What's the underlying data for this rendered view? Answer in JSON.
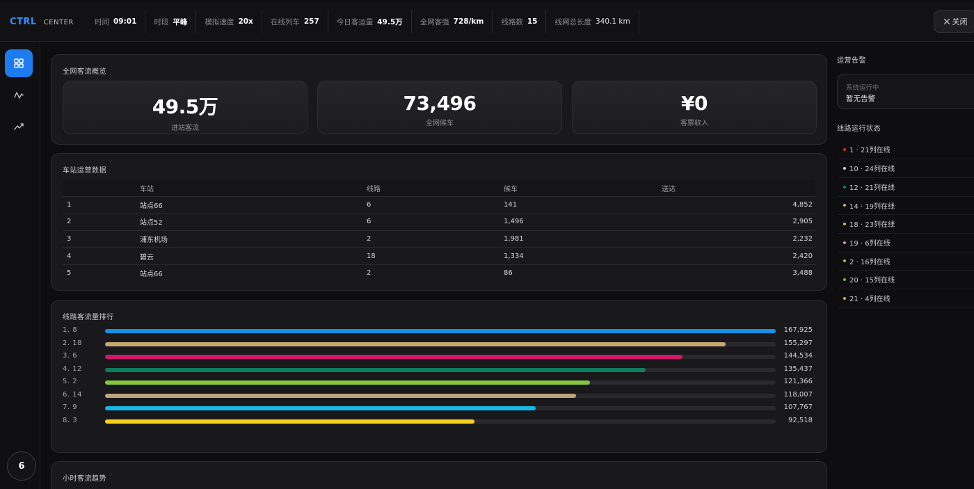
{
  "header": {
    "brand_primary": "CTRL",
    "brand_secondary": "CENTER",
    "stats": [
      {
        "label": "时间",
        "value": "09:01"
      },
      {
        "label": "时段",
        "value": "平峰"
      },
      {
        "label": "模拟速度",
        "value": "20x"
      },
      {
        "label": "在线列车",
        "value": "257"
      },
      {
        "label": "今日客运量",
        "value": "49.5万"
      },
      {
        "label": "全网客强",
        "value": "728/km"
      },
      {
        "label": "线路数",
        "value": "15"
      },
      {
        "label": "线网总长度",
        "value": "340.1 km"
      }
    ],
    "close_label": "关闭"
  },
  "sidebar": {
    "items": [
      {
        "icon": "grid-icon"
      },
      {
        "icon": "pulse-icon"
      },
      {
        "icon": "trend-icon"
      }
    ],
    "badge": "6"
  },
  "overview": {
    "title": "全网客流概览",
    "kpis": [
      {
        "value": "49.5万",
        "label": "进站客流"
      },
      {
        "value": "73,496",
        "label": "全网候车"
      },
      {
        "value": "¥0",
        "label": "客票收入"
      }
    ]
  },
  "stations": {
    "title": "车站运营数据",
    "headers": [
      "",
      "车站",
      "线路",
      "候车",
      "送达"
    ],
    "rows": [
      [
        "1",
        "站点66",
        "6",
        "141",
        "4,852"
      ],
      [
        "2",
        "站点52",
        "6",
        "1,496",
        "2,905"
      ],
      [
        "3",
        "浦东机场",
        "2",
        "1,981",
        "2,232"
      ],
      [
        "4",
        "碧云",
        "18",
        "1,334",
        "2,420"
      ],
      [
        "5",
        "站点66",
        "2",
        "86",
        "3,488"
      ]
    ]
  },
  "ranking": {
    "title": "线路客流量排行",
    "max": 167925,
    "items": [
      {
        "label": "1. 8",
        "value": 167925,
        "display": "167,925",
        "color": "#1592e6"
      },
      {
        "label": "2. 18",
        "value": 155297,
        "display": "155,297",
        "color": "#c9a86f"
      },
      {
        "label": "3. 6",
        "value": 144534,
        "display": "144,534",
        "color": "#d4156d"
      },
      {
        "label": "4. 12",
        "value": 135437,
        "display": "135,437",
        "color": "#0e7d5c"
      },
      {
        "label": "5. 2",
        "value": 121366,
        "display": "121,366",
        "color": "#86c540"
      },
      {
        "label": "6. 14",
        "value": 118007,
        "display": "118,007",
        "color": "#bda57b"
      },
      {
        "label": "7. 9",
        "value": 107767,
        "display": "107,767",
        "color": "#16b6e8"
      },
      {
        "label": "8. 3",
        "value": 92518,
        "display": "92,518",
        "color": "#f6d21a"
      }
    ]
  },
  "hourly": {
    "title": "小时客流趋势"
  },
  "alerts": {
    "title": "运营告警",
    "status": "系统运行中",
    "message": "暂无告警"
  },
  "line_status": {
    "title": "线路运行状态",
    "items": [
      {
        "text": "1 · 21列在线",
        "color": "#e0233c"
      },
      {
        "text": "10 · 24列在线",
        "color": "#d9d2e6"
      },
      {
        "text": "12 · 21列在线",
        "color": "#12876a"
      },
      {
        "text": "14 · 19列在线",
        "color": "#c8b287"
      },
      {
        "text": "18 · 23列在线",
        "color": "#d4b27a"
      },
      {
        "text": "19 · 6列在线",
        "color": "#e88aa8"
      },
      {
        "text": "2 · 16列在线",
        "color": "#8ac64a"
      },
      {
        "text": "20 · 15列在线",
        "color": "#7fb548"
      },
      {
        "text": "21 · 4列在线",
        "color": "#e3a63a"
      }
    ]
  }
}
